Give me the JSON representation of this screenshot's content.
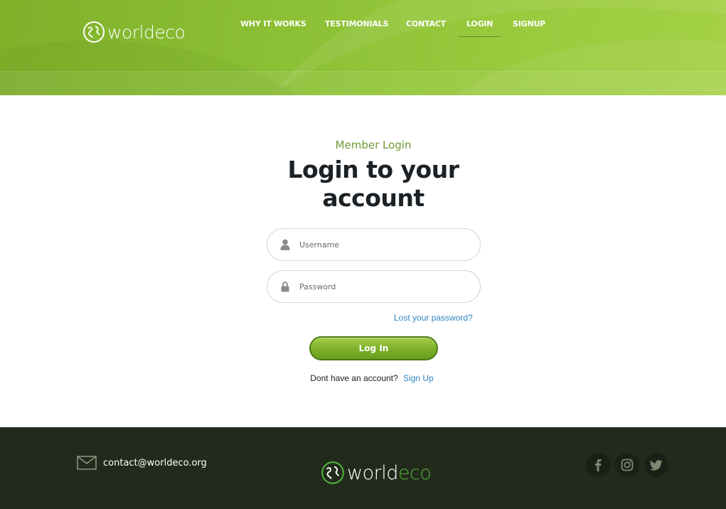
{
  "header": {
    "logo_text": "worldeco",
    "nav": [
      {
        "label": "WHY IT WORKS"
      },
      {
        "label": "TESTIMONIALS"
      },
      {
        "label": "CONTACT"
      },
      {
        "label": "LOGIN",
        "active": true
      },
      {
        "label": "SIGNUP"
      }
    ]
  },
  "login": {
    "eyebrow": "Member Login",
    "title_line1": "Login to your",
    "title_line2": "account",
    "username": {
      "placeholder": "Username",
      "value": "",
      "icon": "user-icon"
    },
    "password": {
      "placeholder": "Password",
      "value": "",
      "icon": "lock-icon"
    },
    "lost_password": "Lost your password?",
    "submit_label": "Log In",
    "no_account_text": "Dont have an account?",
    "signup_link": "Sign Up"
  },
  "footer": {
    "email": "contact@worldeco.org",
    "logo_world": "world",
    "logo_eco": "eco",
    "social": [
      "facebook-icon",
      "instagram-icon",
      "twitter-icon"
    ]
  },
  "colors": {
    "brand_green": "#8cc035",
    "eyebrow_green": "#6e9a33",
    "link_blue": "#2f86c0",
    "footer_bg": "#222a1b"
  }
}
